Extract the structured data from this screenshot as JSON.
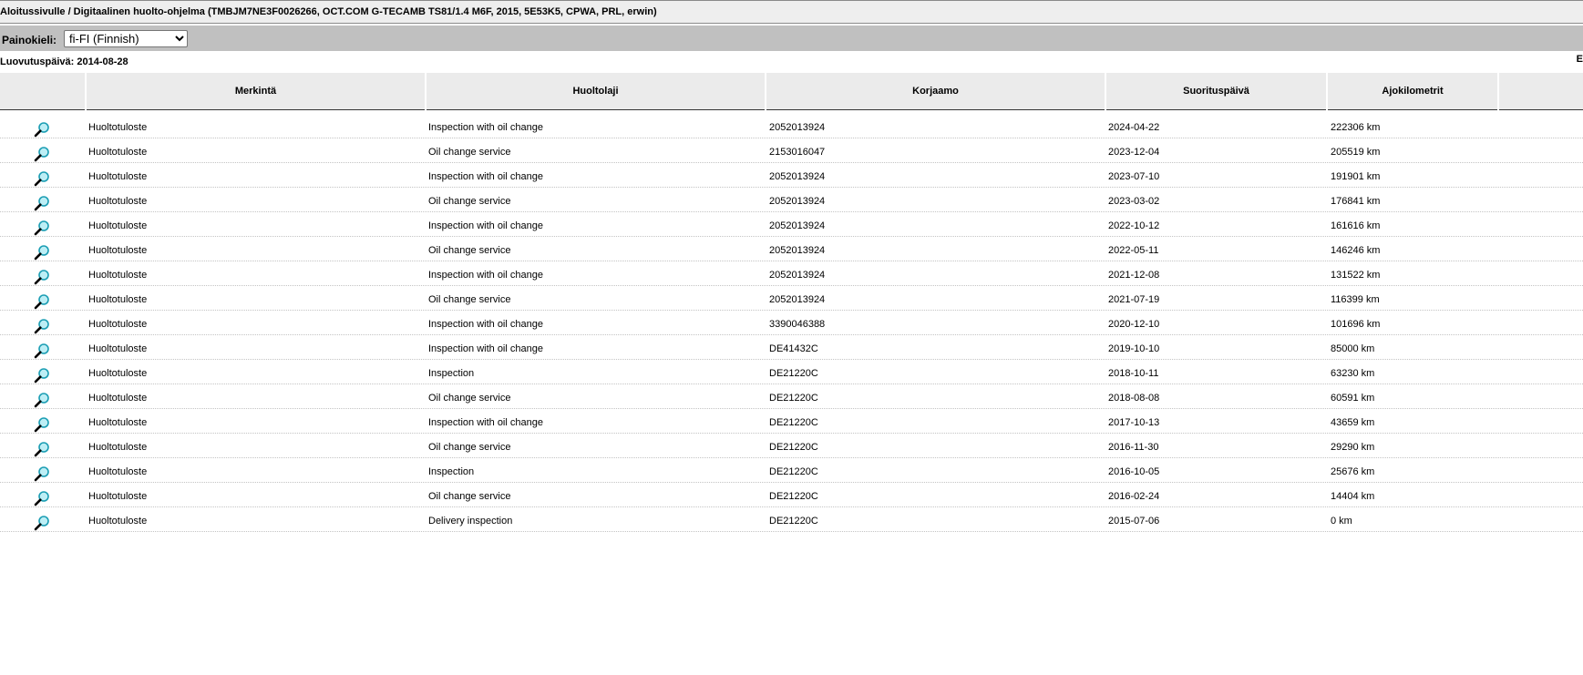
{
  "breadcrumb": "Aloitussivulle / Digitaalinen huolto-ohjelma (TMBJM7NE3F0026266, OCT.COM G-TECAMB TS81/1.4 M6F, 2015, 5E53K5, CPWA, PRL, erwin)",
  "language": {
    "label": "Painokieli:",
    "selected": "fi-FI (Finnish)"
  },
  "corner_text": "E",
  "delivery_date": "Luovutuspäivä: 2014-08-28",
  "table": {
    "headers": [
      "Merkintä",
      "Huoltolaji",
      "Korjaamo",
      "Suorituspäivä",
      "Ajokilometrit"
    ],
    "rows": [
      {
        "entry": "Huoltotuloste",
        "type": "Inspection with oil change",
        "workshop": "2052013924",
        "date": "2024-04-22",
        "km": "222306 km"
      },
      {
        "entry": "Huoltotuloste",
        "type": "Oil change service",
        "workshop": "2153016047",
        "date": "2023-12-04",
        "km": "205519 km"
      },
      {
        "entry": "Huoltotuloste",
        "type": "Inspection with oil change",
        "workshop": "2052013924",
        "date": "2023-07-10",
        "km": "191901 km"
      },
      {
        "entry": "Huoltotuloste",
        "type": "Oil change service",
        "workshop": "2052013924",
        "date": "2023-03-02",
        "km": "176841 km"
      },
      {
        "entry": "Huoltotuloste",
        "type": "Inspection with oil change",
        "workshop": "2052013924",
        "date": "2022-10-12",
        "km": "161616 km"
      },
      {
        "entry": "Huoltotuloste",
        "type": "Oil change service",
        "workshop": "2052013924",
        "date": "2022-05-11",
        "km": "146246 km"
      },
      {
        "entry": "Huoltotuloste",
        "type": "Inspection with oil change",
        "workshop": "2052013924",
        "date": "2021-12-08",
        "km": "131522 km"
      },
      {
        "entry": "Huoltotuloste",
        "type": "Oil change service",
        "workshop": "2052013924",
        "date": "2021-07-19",
        "km": "116399 km"
      },
      {
        "entry": "Huoltotuloste",
        "type": "Inspection with oil change",
        "workshop": "3390046388",
        "date": "2020-12-10",
        "km": "101696 km"
      },
      {
        "entry": "Huoltotuloste",
        "type": "Inspection with oil change",
        "workshop": "DE41432C",
        "date": "2019-10-10",
        "km": "85000 km"
      },
      {
        "entry": "Huoltotuloste",
        "type": "Inspection",
        "workshop": "DE21220C",
        "date": "2018-10-11",
        "km": "63230 km"
      },
      {
        "entry": "Huoltotuloste",
        "type": "Oil change service",
        "workshop": "DE21220C",
        "date": "2018-08-08",
        "km": "60591 km"
      },
      {
        "entry": "Huoltotuloste",
        "type": "Inspection with oil change",
        "workshop": "DE21220C",
        "date": "2017-10-13",
        "km": "43659 km"
      },
      {
        "entry": "Huoltotuloste",
        "type": "Oil change service",
        "workshop": "DE21220C",
        "date": "2016-11-30",
        "km": "29290 km"
      },
      {
        "entry": "Huoltotuloste",
        "type": "Inspection",
        "workshop": "DE21220C",
        "date": "2016-10-05",
        "km": "25676 km"
      },
      {
        "entry": "Huoltotuloste",
        "type": "Oil change service",
        "workshop": "DE21220C",
        "date": "2016-02-24",
        "km": "14404 km"
      },
      {
        "entry": "Huoltotuloste",
        "type": "Delivery inspection",
        "workshop": "DE21220C",
        "date": "2015-07-06",
        "km": "0 km"
      }
    ]
  },
  "icons": {
    "row_action": "magnifier-icon"
  },
  "colors": {
    "header_bg": "#ebebeb",
    "langbar_bg": "#c0c0c0",
    "topbar_bg": "#eeeeee",
    "magnifier": "#20b2c8"
  }
}
